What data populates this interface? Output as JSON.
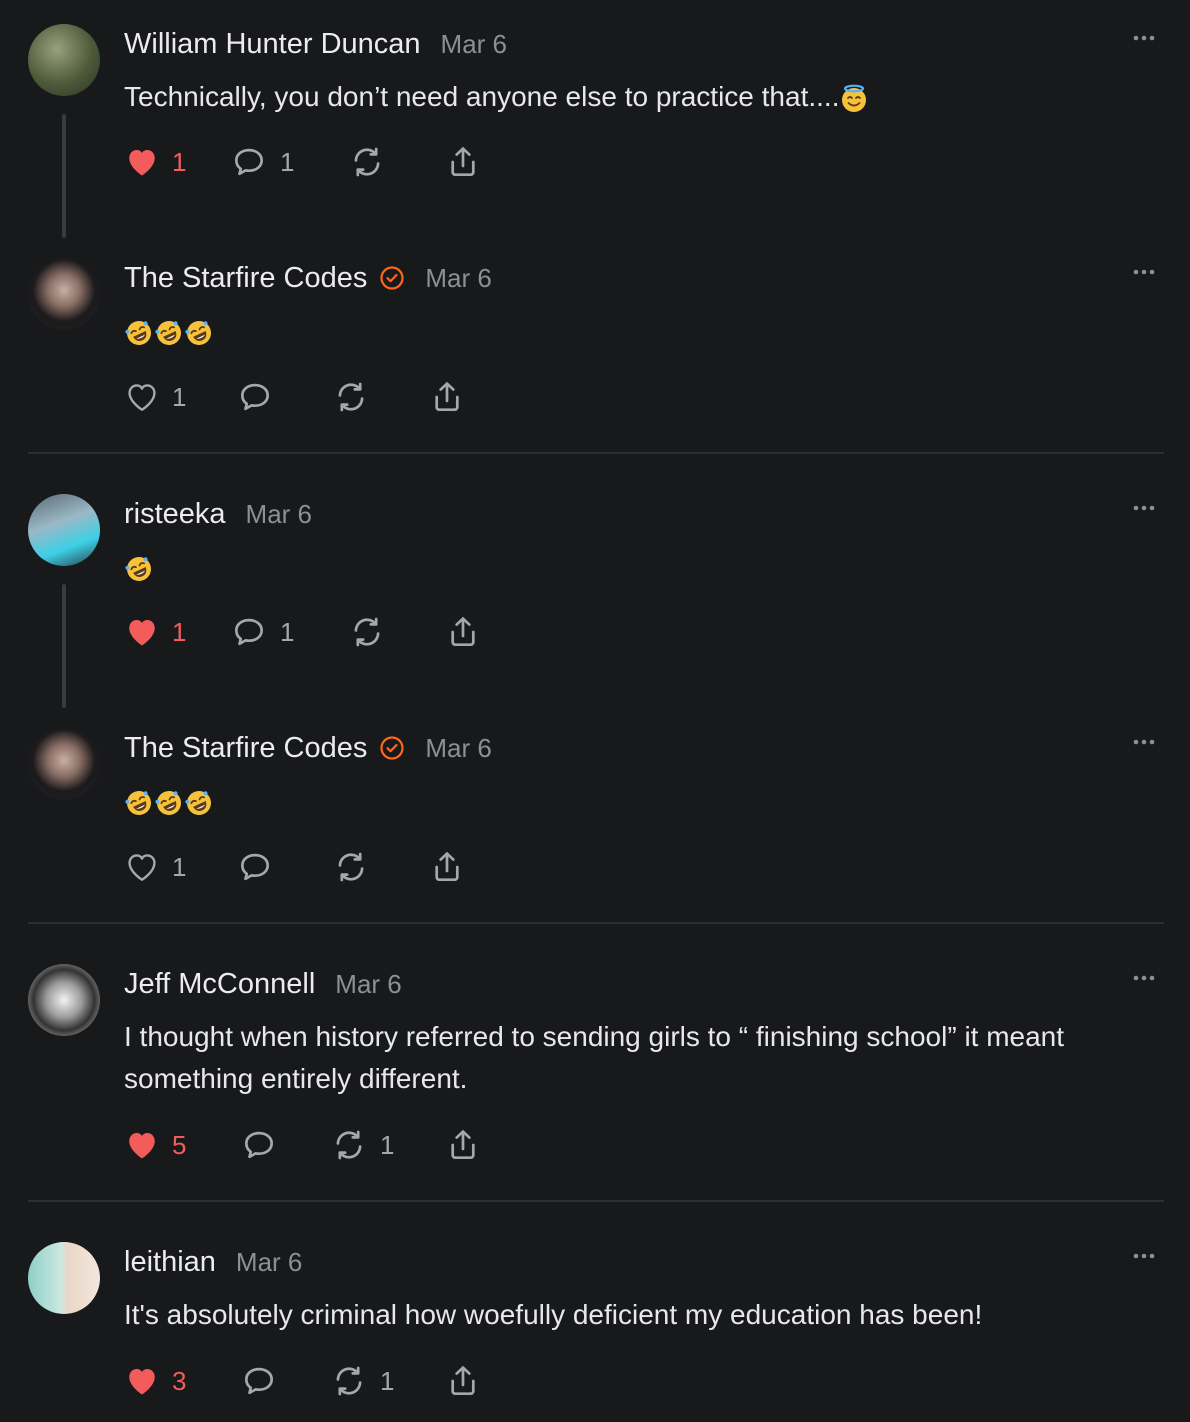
{
  "comments": [
    {
      "author": "William Hunter Duncan",
      "verified": false,
      "date": "Mar 6",
      "text": "Technically, you don’t need anyone else to practice that....",
      "emoji": "smiling-face-with-halo",
      "likes": "1",
      "liked": true,
      "replies": "1",
      "restacks": ""
    },
    {
      "author": "The Starfire Codes",
      "verified": true,
      "date": "Mar 6",
      "text": "",
      "emoji": "rolling-on-floor-laughing x3",
      "likes": "1",
      "liked": false,
      "replies": "",
      "restacks": ""
    },
    {
      "author": "risteeka",
      "verified": false,
      "date": "Mar 6",
      "text": "",
      "emoji": "rolling-on-floor-laughing",
      "likes": "1",
      "liked": true,
      "replies": "1",
      "restacks": ""
    },
    {
      "author": "The Starfire Codes",
      "verified": true,
      "date": "Mar 6",
      "text": "",
      "emoji": "rolling-on-floor-laughing x3",
      "likes": "1",
      "liked": false,
      "replies": "",
      "restacks": ""
    },
    {
      "author": "Jeff McConnell",
      "verified": false,
      "date": "Mar 6",
      "text": "I thought when history referred to sending girls to “ finishing school” it meant something entirely different.",
      "emoji": "",
      "likes": "5",
      "liked": true,
      "replies": "",
      "restacks": "1"
    },
    {
      "author": "leithian",
      "verified": false,
      "date": "Mar 6",
      "text": "It's absolutely criminal how woefully deficient my education has been!",
      "emoji": "",
      "likes": "3",
      "liked": true,
      "replies": "",
      "restacks": "1"
    }
  ],
  "colors": {
    "background": "#18191b",
    "liked": "#f45c5c",
    "verified": "#ff6719",
    "muted": "#8d8f94"
  }
}
